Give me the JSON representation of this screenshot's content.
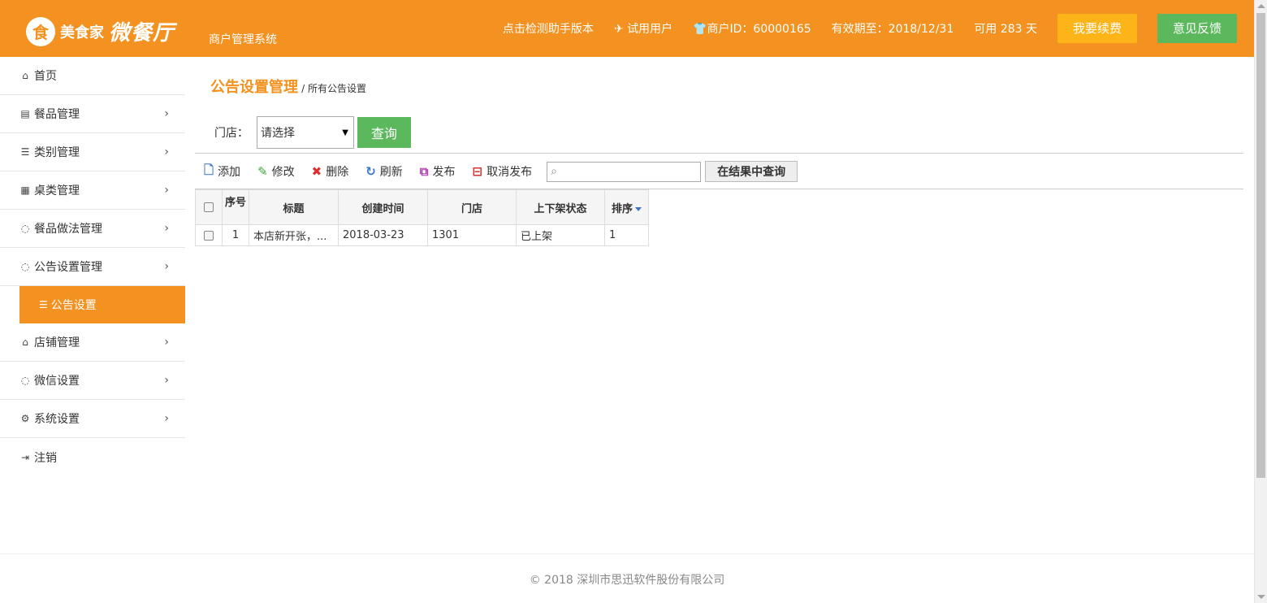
{
  "header": {
    "logo_icon": "食",
    "brand": "美食家",
    "product": "微餐厅",
    "system_name": "商户管理系统",
    "check_version": "点击检测助手版本",
    "trial_user": "试用用户",
    "merchant_id": "商户ID：60000165",
    "valid_until": "有效期至：2018/12/31",
    "days_left": "可用 283 天",
    "renew_button": "我要续费",
    "feedback_button": "意见反馈",
    "accent_color": "#f39220"
  },
  "sidebar": {
    "items": [
      {
        "label": "首页",
        "icon": "home-icon"
      },
      {
        "label": "餐品管理",
        "icon": "list-alt-icon"
      },
      {
        "label": "类别管理",
        "icon": "list-icon"
      },
      {
        "label": "桌类管理",
        "icon": "table-icon"
      },
      {
        "label": "餐品做法管理",
        "icon": "comments-icon"
      },
      {
        "label": "公告设置管理",
        "icon": "comments-icon"
      },
      {
        "label": "公告设置",
        "icon": "indent-icon"
      },
      {
        "label": "店铺管理",
        "icon": "bank-icon"
      },
      {
        "label": "微信设置",
        "icon": "comments-icon"
      },
      {
        "label": "系统设置",
        "icon": "gears-icon"
      },
      {
        "label": "注销",
        "icon": "sign-out-icon"
      }
    ]
  },
  "page": {
    "title": "公告设置管理",
    "subtitle": "/ 所有公告设置"
  },
  "filter": {
    "store_label": "门店：",
    "store_select_value": "请选择",
    "query_button": "查询"
  },
  "toolbar": {
    "add": "添加",
    "edit": "修改",
    "delete": "删除",
    "refresh": "刷新",
    "publish": "发布",
    "unpublish": "取消发布",
    "search_placeholder": "",
    "search_in_results": "在结果中查询"
  },
  "table": {
    "headers": [
      "序号",
      "标题",
      "创建时间",
      "门店",
      "上下架状态",
      "排序"
    ],
    "rows": [
      {
        "index": "1",
        "title": "本店新开张，...",
        "created": "2018-03-23",
        "store": "1301",
        "status": "已上架",
        "order": "1"
      }
    ]
  },
  "footer": {
    "copyright": "© 2018 深圳市思迅软件股份有限公司"
  }
}
